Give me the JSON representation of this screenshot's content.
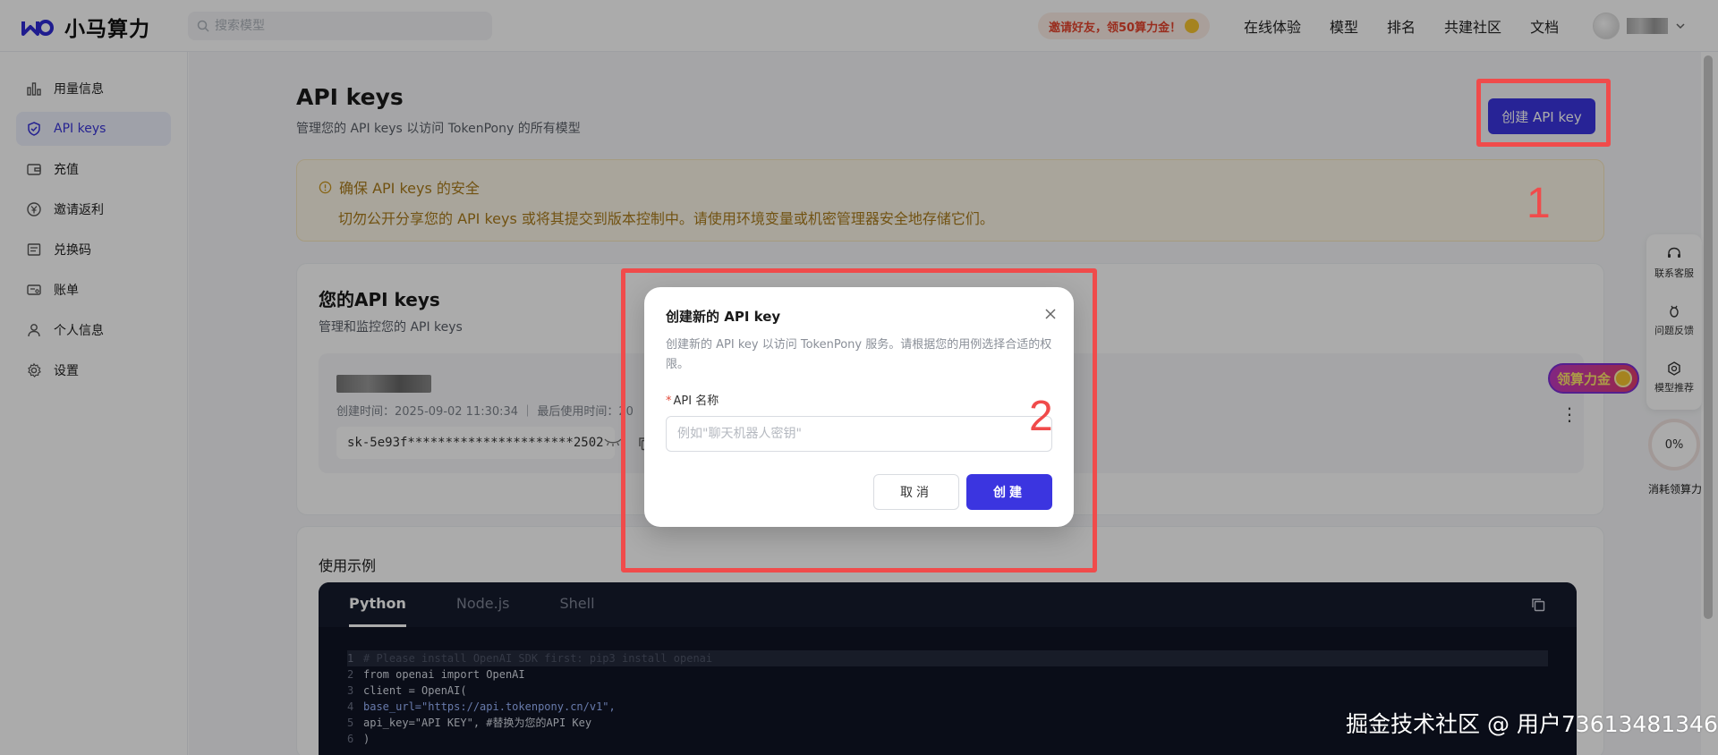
{
  "brand": {
    "name": "小马算力"
  },
  "search": {
    "placeholder": "搜索模型"
  },
  "header": {
    "invite": "邀请好友，领50算力金！",
    "nav": [
      "在线体验",
      "模型",
      "排名",
      "共建社区",
      "文档"
    ]
  },
  "sidebar": {
    "items": [
      {
        "label": "用量信息",
        "icon": "bar-chart-icon"
      },
      {
        "label": "API keys",
        "icon": "shield-icon",
        "active": true
      },
      {
        "label": "充值",
        "icon": "wallet-icon"
      },
      {
        "label": "邀请返利",
        "icon": "yen-coin-icon"
      },
      {
        "label": "兑换码",
        "icon": "ticket-icon"
      },
      {
        "label": "账单",
        "icon": "bill-icon"
      },
      {
        "label": "个人信息",
        "icon": "user-icon"
      },
      {
        "label": "设置",
        "icon": "gear-icon"
      }
    ]
  },
  "page": {
    "title": "API keys",
    "subtitle": "管理您的 API keys 以访问 TokenPony 的所有模型",
    "create_button": "创建 API key"
  },
  "annotations": {
    "one": "1",
    "two": "2"
  },
  "warning": {
    "title": "确保 API keys 的安全",
    "text": "切勿公开分享您的 API keys 或将其提交到版本控制中。请使用环境变量或机密管理器安全地存储它们。"
  },
  "keys_card": {
    "title": "您的API keys",
    "subtitle": "管理和监控您的 API keys",
    "key": {
      "meta": "创建时间：2025-09-02 11:30:34  ｜  最后使用时间：20",
      "value": "sk-5e93f**********************2502"
    }
  },
  "example": {
    "title": "使用示例",
    "tabs": [
      "Python",
      "Node.js",
      "Shell"
    ],
    "active_tab": "Python",
    "lines": [
      {
        "n": "1",
        "text": "# Please install OpenAI SDK first:  pip3 install openai"
      },
      {
        "n": "2",
        "text": "from openai import OpenAI"
      },
      {
        "n": "3",
        "text": "client = OpenAI("
      },
      {
        "n": "4",
        "text": "  base_url=\"https://api.tokenpony.cn/v1\","
      },
      {
        "n": "5",
        "text": "  api_key=\"API KEY\", #替换为您的API Key"
      },
      {
        "n": "6",
        "text": ")"
      }
    ]
  },
  "float_tools": {
    "items": [
      {
        "label": "联系客服",
        "icon": "headset-icon"
      },
      {
        "label": "问题反馈",
        "icon": "bug-icon"
      },
      {
        "label": "模型推荐",
        "icon": "openai-icon"
      }
    ],
    "gold": "领算力金",
    "gauge_value": "0%",
    "gauge_label": "消耗领算力"
  },
  "modal": {
    "title": "创建新的 API key",
    "description": "创建新的 API key 以访问 TokenPony 服务。请根据您的用例选择合适的权限。",
    "field_label": "API 名称",
    "required_mark": "*",
    "placeholder": "例如\"聊天机器人密钥\"",
    "cancel": "取消",
    "confirm": "创建"
  },
  "watermark": "掘金技术社区 @ 用户73613481346"
}
